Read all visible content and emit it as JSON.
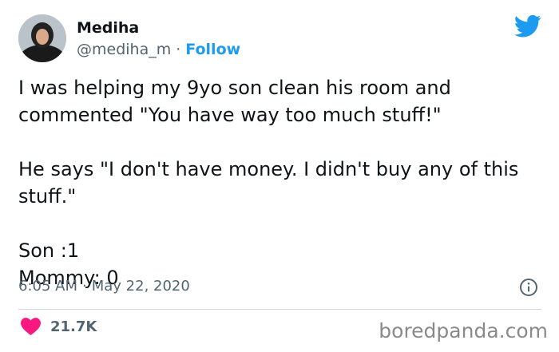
{
  "author": {
    "name": "Mediha",
    "handle": "@mediha_m",
    "separator": "·",
    "follow_label": "Follow"
  },
  "brand_icon": "twitter-bird-icon",
  "tweet": {
    "paragraphs": [
      "I was helping my 9yo son clean his room and commented \"You have way too much stuff!\"",
      "He says \"I don't have money. I didn't buy any of this stuff.\""
    ],
    "score_lines": [
      "Son :1",
      "Mommy: 0"
    ]
  },
  "meta": {
    "time": "6:05 AM",
    "separator": "·",
    "date": "May 22, 2020",
    "info_icon": "info-icon"
  },
  "engagement": {
    "likes": "21.7K",
    "like_icon": "heart-icon"
  },
  "watermark": "boredpanda.com",
  "colors": {
    "accent": "#1d9bf0",
    "heart": "#f91880",
    "text": "#0f1419",
    "muted": "#536471"
  }
}
